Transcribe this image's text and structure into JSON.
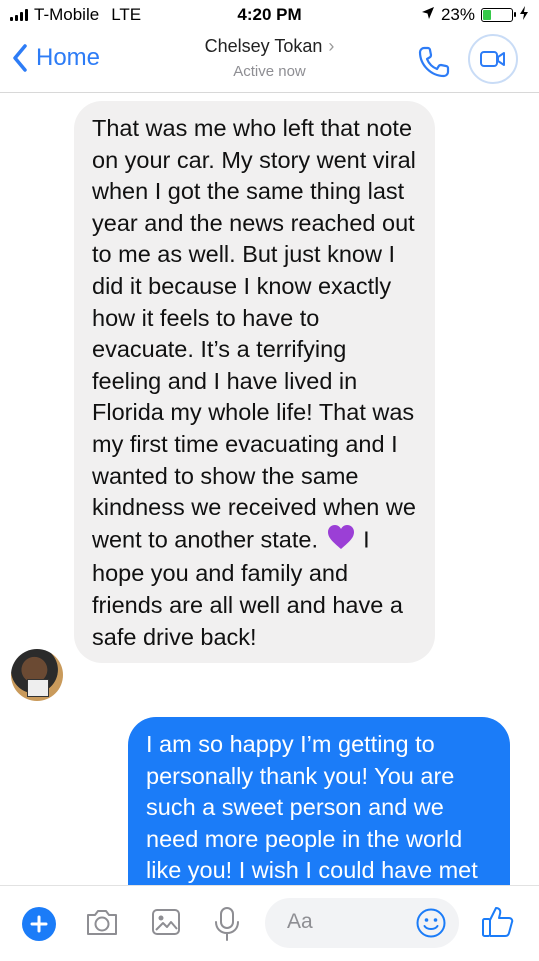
{
  "status_bar": {
    "carrier": "T-Mobile",
    "network": "LTE",
    "time": "4:20 PM",
    "battery": "23%"
  },
  "nav": {
    "back_label": "Home",
    "contact_name": "Chelsey Tokan",
    "contact_status": "Active now"
  },
  "messages": {
    "incoming": {
      "text_part1": "That was me who left that note on your car. My story went viral when I got the same thing last year and the news reached out to me as well. But just know I did it because I know exactly how it feels to have to evacuate. It’s a terrifying feeling and I have lived in Florida my whole life! That was my first time evacuating and I wanted to show the same kindness we received when we went to another state.",
      "emoji": "purple-heart",
      "text_part2": "I hope you and family and friends are all well and have a safe drive back!"
    },
    "outgoing": {
      "text": "I am so happy I’m getting to personally thank you! You are such a sweet person and we need more people in the world like you! I wish I could have met"
    }
  },
  "composer": {
    "placeholder": "Aa"
  },
  "colors": {
    "accent": "#1b7cf8",
    "incoming_bubble": "#f1f0f0",
    "outgoing_bubble": "#1b7cf8"
  }
}
